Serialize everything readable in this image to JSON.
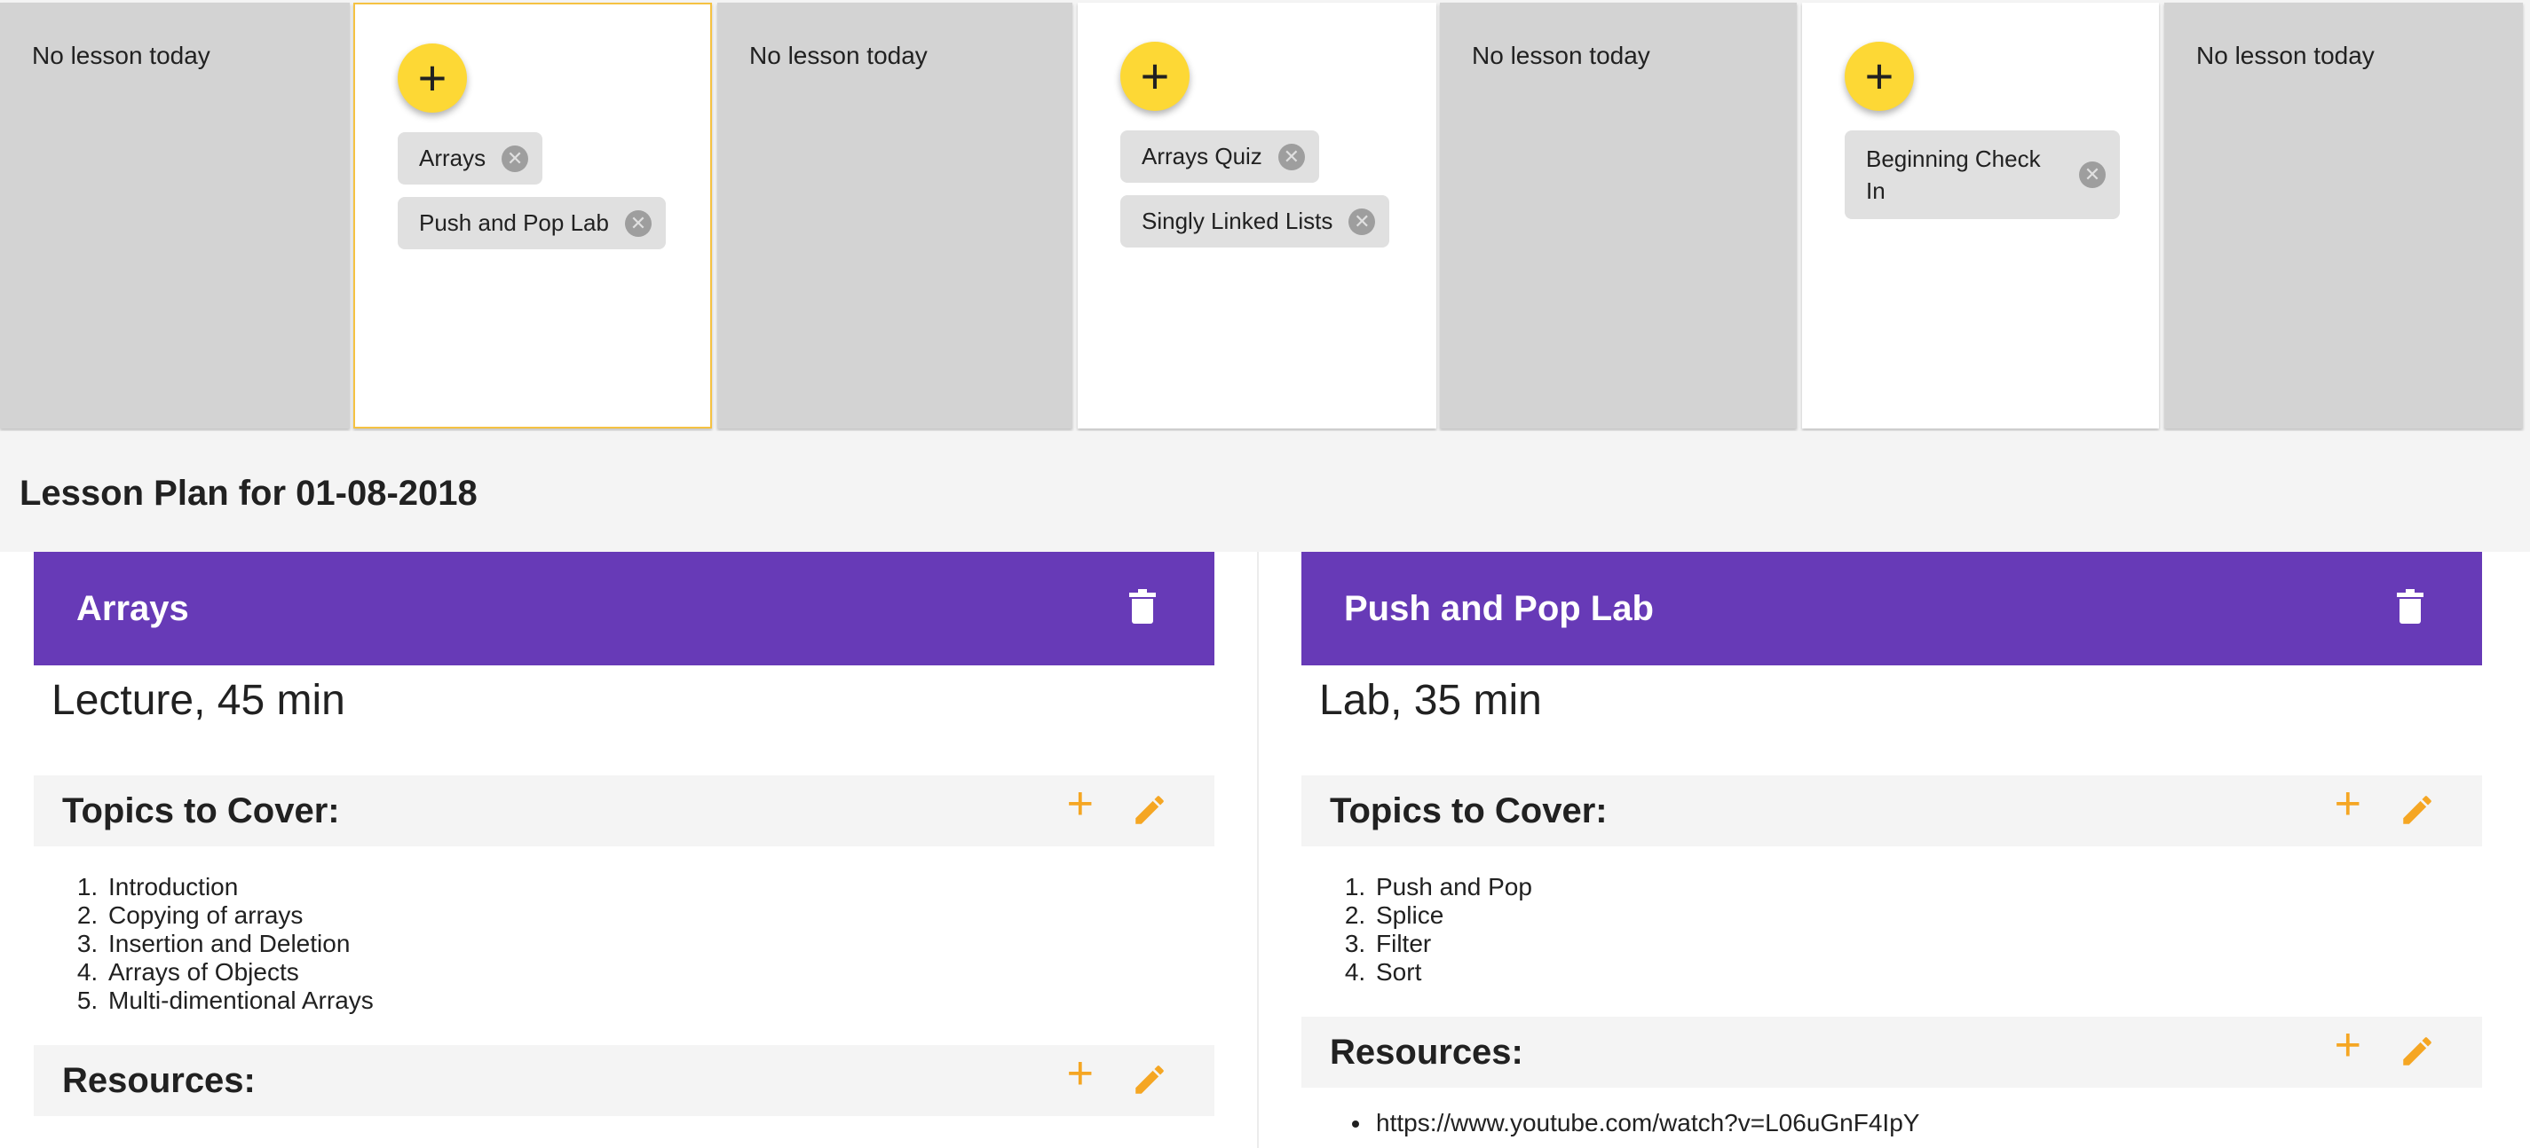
{
  "week": {
    "days": [
      {
        "type": "empty",
        "label": "No lesson today"
      },
      {
        "type": "lesson",
        "selected": true,
        "add_label": "+",
        "chips": [
          {
            "label": "Arrays"
          },
          {
            "label": "Push and Pop Lab"
          }
        ]
      },
      {
        "type": "empty",
        "label": "No lesson today"
      },
      {
        "type": "lesson",
        "add_label": "+",
        "chips": [
          {
            "label": "Arrays Quiz"
          },
          {
            "label": "Singly Linked Lists"
          }
        ]
      },
      {
        "type": "empty",
        "label": "No lesson today"
      },
      {
        "type": "lesson",
        "add_label": "+",
        "chips": [
          {
            "label": "Beginning Check In"
          }
        ]
      },
      {
        "type": "empty",
        "label": "No lesson today"
      }
    ],
    "chip_remove_glyph": "✕"
  },
  "plan": {
    "title": "Lesson Plan for 01-08-2018",
    "cards": [
      {
        "title": "Arrays",
        "meta": "Lecture, 45 min",
        "topics_label": "Topics to Cover:",
        "topics": [
          "Introduction",
          "Copying of arrays",
          "Insertion and Deletion",
          "Arrays of Objects",
          "Multi-dimentional Arrays"
        ],
        "resources_label": "Resources:",
        "resources": []
      },
      {
        "title": "Push and Pop Lab",
        "meta": "Lab, 35 min",
        "topics_label": "Topics to Cover:",
        "topics": [
          "Push and Pop",
          "Splice",
          "Filter",
          "Sort"
        ],
        "resources_label": "Resources:",
        "resources": [
          "https://www.youtube.com/watch?v=L06uGnF4IpY"
        ]
      }
    ],
    "add_glyph": "+"
  },
  "colors": {
    "accent_purple": "#673ab7",
    "fab_yellow": "#fdd835",
    "action_orange": "#f5a623",
    "selected_border": "#f5c242",
    "empty_day": "#d3d3d3"
  },
  "icons": {
    "fab": "plus-icon",
    "chip_remove": "close-circle-icon",
    "card_delete": "trash-icon",
    "section_add": "plus-icon",
    "section_edit": "pencil-icon"
  }
}
